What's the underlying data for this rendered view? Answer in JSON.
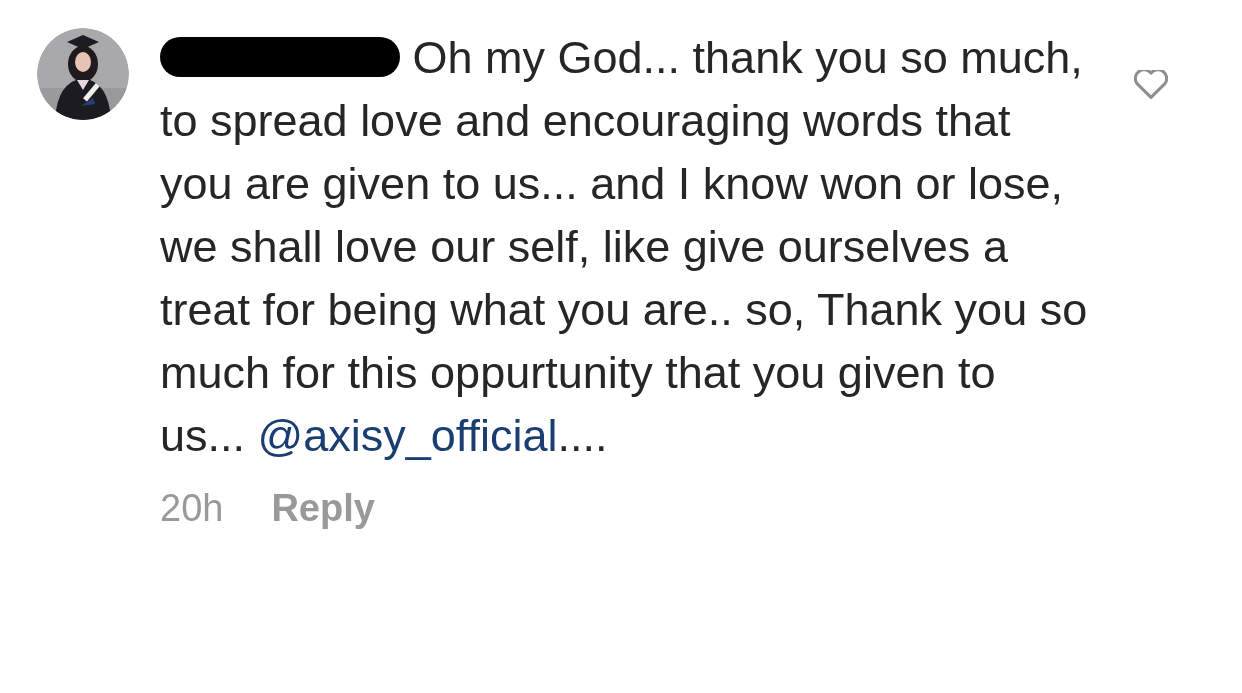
{
  "comment": {
    "username": {
      "redacted": true
    },
    "text": "Oh my God... thank you so much, to spread love and encouraging words that you are given to us... and I know won or lose, we shall love our self, like give ourselves a treat for being what you are.. so, Thank you so much for this oppurtunity that you given to us...",
    "mention": "@axisy_official",
    "trailing": "....",
    "liked": false,
    "time": "20h",
    "reply": "Reply"
  }
}
